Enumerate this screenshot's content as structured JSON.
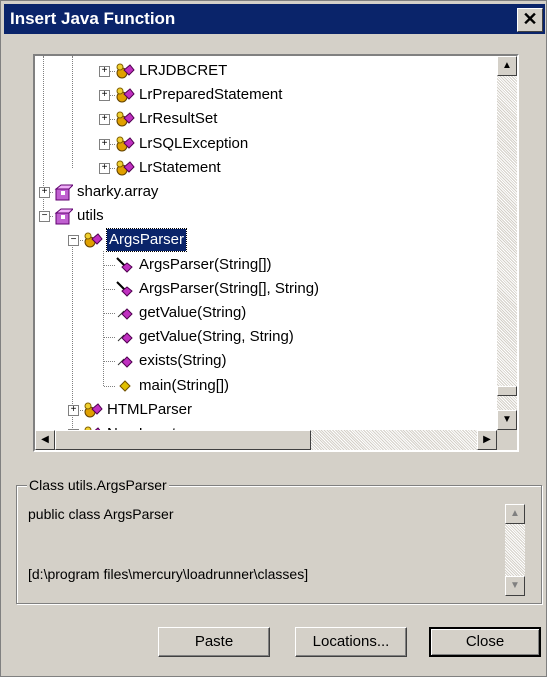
{
  "window": {
    "title": "Insert Java Function",
    "close_glyph": "✕"
  },
  "tree": {
    "nodes": [
      {
        "label": "LRJDBCRET",
        "icon": "java-class-icon",
        "expander": "+"
      },
      {
        "label": "LrPreparedStatement",
        "icon": "java-class-icon",
        "expander": "+"
      },
      {
        "label": "LrResultSet",
        "icon": "java-class-icon",
        "expander": "+"
      },
      {
        "label": "LrSQLException",
        "icon": "java-class-icon",
        "expander": "+"
      },
      {
        "label": "LrStatement",
        "icon": "java-class-icon",
        "expander": "+"
      },
      {
        "label": "sharky.array",
        "icon": "package-icon",
        "expander": "+"
      },
      {
        "label": "utils",
        "icon": "package-icon",
        "expander": "−"
      },
      {
        "label": "ArgsParser",
        "icon": "java-class-icon",
        "expander": "−",
        "selected": true
      },
      {
        "label": "ArgsParser(String[])",
        "icon": "constructor-icon"
      },
      {
        "label": "ArgsParser(String[], String)",
        "icon": "constructor-icon"
      },
      {
        "label": "getValue(String)",
        "icon": "method-icon"
      },
      {
        "label": "getValue(String, String)",
        "icon": "method-icon"
      },
      {
        "label": "exists(String)",
        "icon": "method-icon"
      },
      {
        "label": "main(String[])",
        "icon": "static-method-icon"
      },
      {
        "label": "HTMLParser",
        "icon": "java-class-icon",
        "expander": "+"
      },
      {
        "label": "NumInserter",
        "icon": "java-class-icon",
        "expander": "+"
      }
    ]
  },
  "details": {
    "legend": "Class utils.ArgsParser",
    "declaration": "public class ArgsParser",
    "path": "[d:\\program files\\mercury\\loadrunner\\classes]"
  },
  "buttons": {
    "paste": "Paste",
    "locations": "Locations...",
    "close": "Close"
  },
  "scroll_glyphs": {
    "up": "▲",
    "down": "▼",
    "left": "◀",
    "right": "▶"
  },
  "colors": {
    "title_bar": "#0a246a",
    "dialog_bg": "#d4d0c8",
    "selection": "#0a246a"
  }
}
